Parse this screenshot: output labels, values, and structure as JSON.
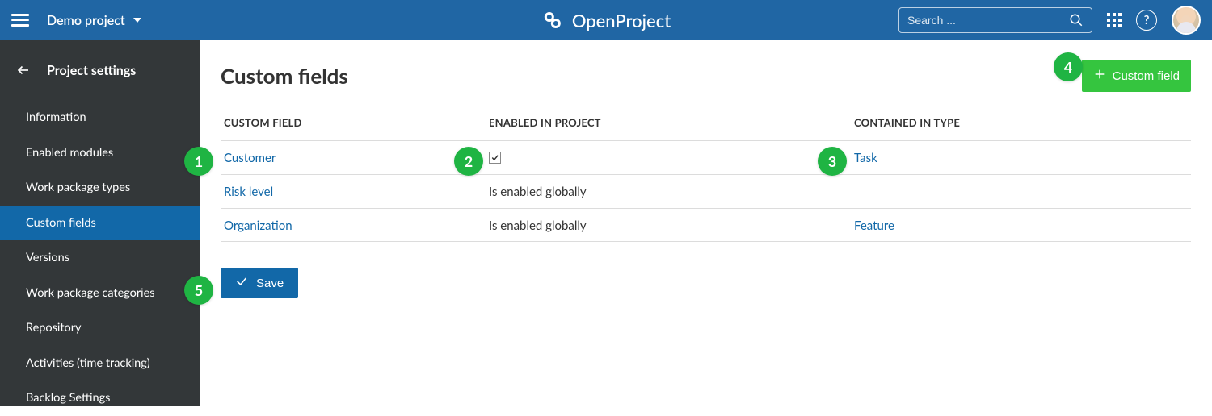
{
  "header": {
    "project_name": "Demo project",
    "brand": "OpenProject",
    "search_placeholder": "Search ..."
  },
  "sidebar": {
    "title": "Project settings",
    "items": [
      {
        "label": "Information",
        "active": false
      },
      {
        "label": "Enabled modules",
        "active": false
      },
      {
        "label": "Work package types",
        "active": false
      },
      {
        "label": "Custom fields",
        "active": true
      },
      {
        "label": "Versions",
        "active": false
      },
      {
        "label": "Work package categories",
        "active": false
      },
      {
        "label": "Repository",
        "active": false
      },
      {
        "label": "Activities (time tracking)",
        "active": false
      },
      {
        "label": "Backlog Settings",
        "active": false
      }
    ]
  },
  "main": {
    "title": "Custom fields",
    "add_button_label": "Custom field",
    "save_button_label": "Save",
    "columns": {
      "name": "CUSTOM FIELD",
      "enabled": "ENABLED IN PROJECT",
      "type": "CONTAINED IN TYPE"
    },
    "rows": [
      {
        "name": "Customer",
        "enabled_text": "",
        "enabled_checkbox": true,
        "type": "Task"
      },
      {
        "name": "Risk level",
        "enabled_text": "Is enabled globally",
        "enabled_checkbox": false,
        "type": ""
      },
      {
        "name": "Organization",
        "enabled_text": "Is enabled globally",
        "enabled_checkbox": false,
        "type": "Feature"
      }
    ]
  },
  "callouts": [
    "1",
    "2",
    "3",
    "4",
    "5"
  ],
  "colors": {
    "accent": "#1268A8",
    "green": "#35C53F"
  }
}
